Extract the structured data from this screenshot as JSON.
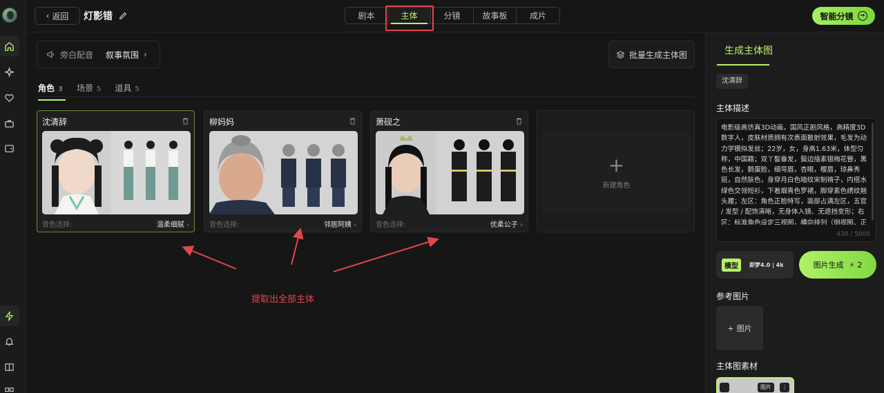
{
  "header": {
    "back_label": "返回",
    "project_title": "灯影错",
    "tabs": [
      {
        "label": "剧本",
        "active": false
      },
      {
        "label": "主体",
        "active": true
      },
      {
        "label": "分镜",
        "active": false
      },
      {
        "label": "故事板",
        "active": false
      },
      {
        "label": "成片",
        "active": false
      }
    ],
    "smart_button": "智能分镜"
  },
  "toolbar": {
    "narration_label": "旁白配音",
    "narration_mood": "叙事氛围",
    "batch_label": "批量生成主体图"
  },
  "categories": [
    {
      "label": "角色",
      "count": "3",
      "active": true
    },
    {
      "label": "场景",
      "count": "5",
      "active": false
    },
    {
      "label": "道具",
      "count": "5",
      "active": false
    }
  ],
  "characters": [
    {
      "name": "沈清辞",
      "voice_label": "音色选择:",
      "voice": "温柔细腻"
    },
    {
      "name": "柳妈妈",
      "voice_label": "音色选择:",
      "voice": "邻居阿姨"
    },
    {
      "name": "萧砚之",
      "voice_label": "音色选择:",
      "voice": "优柔公子"
    }
  ],
  "new_card_label": "新建角色",
  "annotation": "提取出全部主体",
  "panel": {
    "title": "生成主体图",
    "selected_name": "沈清辞",
    "desc_label": "主体描述",
    "description": "电影级高仿真3D动画，国风正剧风格，高精度3D数字人，皮肤材质拥有次表面散射效果，毛发为动力学模拟发丝；22岁，女，身高1.63米，体型匀称，中国籍；双丫髻垂发，鬓边插素银梅花簪，黑色长发，鹅蛋脸，细弯眉，杏眼，樱唇，琼鼻秀挺，自然肤色，身穿月白色暗纹宋制褙子，内搭水绿色交领短衫，下着烟青色罗裙，脚穿素色绣纹翘头履；左区：角色正脸特写，面部占满左区，五官 / 发型 / 配饰清晰，无身体入镜、无遮挡变形；右区：标准角色设定三视图，横向排列（侧视图、正",
    "char_count": "438 / 5000",
    "model_tag": "模型",
    "model_value": "即梦4.0 | 4k",
    "generate_label": "图片生成",
    "generate_cost": "2",
    "ref_label": "参考图片",
    "ref_add": "图片",
    "material_label": "主体图素材",
    "material_badge": "图片"
  },
  "colors": {
    "accent": "#b6f36a",
    "annotation_red": "#e0474c",
    "background": "#161616"
  }
}
